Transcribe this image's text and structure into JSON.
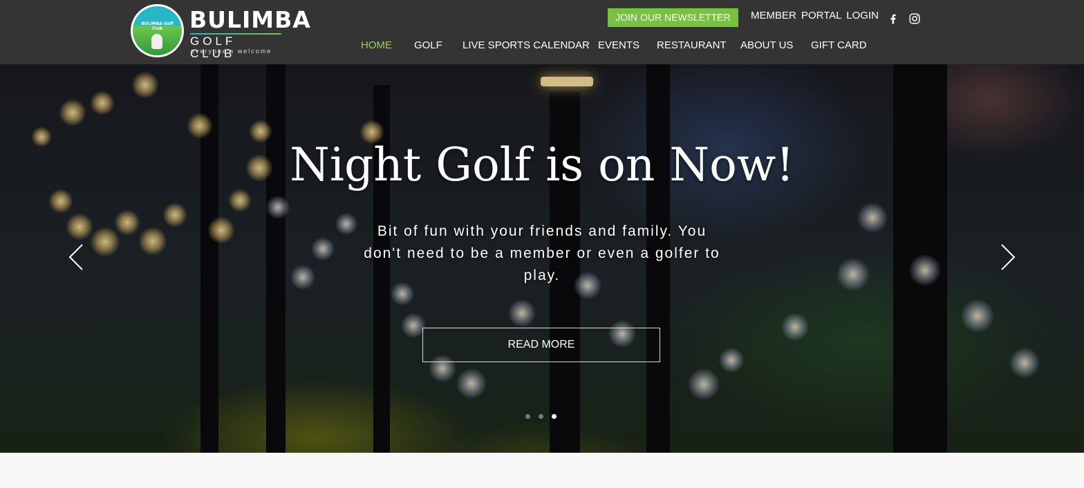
{
  "logo": {
    "name": "BULIMBA",
    "subtitle": "GOLF CLUB",
    "tagline": "everyone's welcome",
    "badge_text": "BULIMBA Golf Club",
    "colors": {
      "teal": "#27b7c6",
      "green": "#6fc74a"
    }
  },
  "header": {
    "newsletter_label": "JOIN OUR NEWSLETTER",
    "portal_label": "MEMBER  PORTAL LOGIN",
    "social": [
      "facebook-icon",
      "instagram-icon"
    ],
    "background": "#343434",
    "accent": "#79c142"
  },
  "nav": {
    "items": [
      {
        "label": "HOME",
        "active": true
      },
      {
        "label": "GOLF"
      },
      {
        "label": "LIVE SPORTS CALENDAR"
      },
      {
        "label": "EVENTS"
      },
      {
        "label": "RESTAURANT"
      },
      {
        "label": "ABOUT US"
      },
      {
        "label": "GIFT CARD"
      }
    ],
    "active_color": "#9fcf62"
  },
  "hero": {
    "title": "Night Golf is on Now!",
    "subtitle": "Bit of fun with your friends and family. You don't need to be a member or even a golfer to play.",
    "button_label": "READ MORE",
    "slides": {
      "count": 3,
      "current": 3
    },
    "prev_icon": "chevron-left-icon",
    "next_icon": "chevron-right-icon"
  }
}
